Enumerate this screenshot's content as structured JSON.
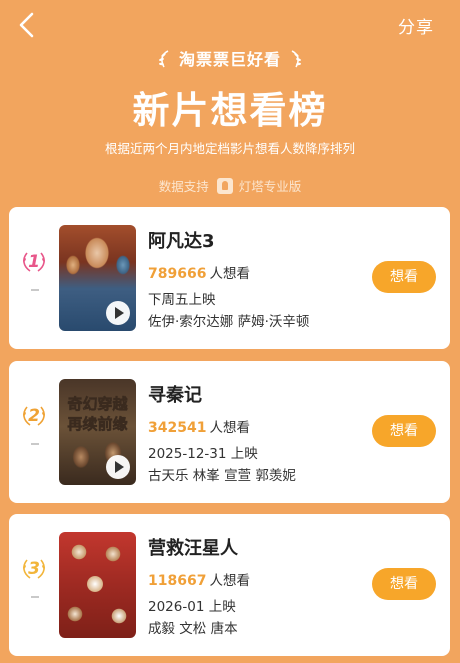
{
  "header": {
    "share_label": "分享",
    "brand": "淘票票巨好看",
    "title": "新片想看榜",
    "subtitle": "根据近两个月内地定档影片想看人数降序排列",
    "source_prefix": "数据支持",
    "source_name": "灯塔专业版"
  },
  "colors": {
    "background": "#F2A55E",
    "accent": "#F7A62A",
    "want_number": "#F0A038",
    "rank_1": "#E8578A",
    "rank_2": "#EFA234",
    "rank_3": "#F2B53A"
  },
  "movies": [
    {
      "rank": "1",
      "title": "阿凡达3",
      "want_count": "789666",
      "want_suffix": "人想看",
      "release": "下周五上映",
      "cast": "佐伊·索尔达娜 萨姆·沃辛顿",
      "button": "想看"
    },
    {
      "rank": "2",
      "title": "寻秦记",
      "want_count": "342541",
      "want_suffix": "人想看",
      "release": "2025-12-31 上映",
      "cast": "古天乐 林峯 宣萱 郭羡妮",
      "poster_text": "奇幻穿越再续前缘",
      "button": "想看"
    },
    {
      "rank": "3",
      "title": "营救汪星人",
      "want_count": "118667",
      "want_suffix": "人想看",
      "release": "2026-01 上映",
      "cast": "成毅 文松 唐本",
      "button": "想看"
    }
  ]
}
